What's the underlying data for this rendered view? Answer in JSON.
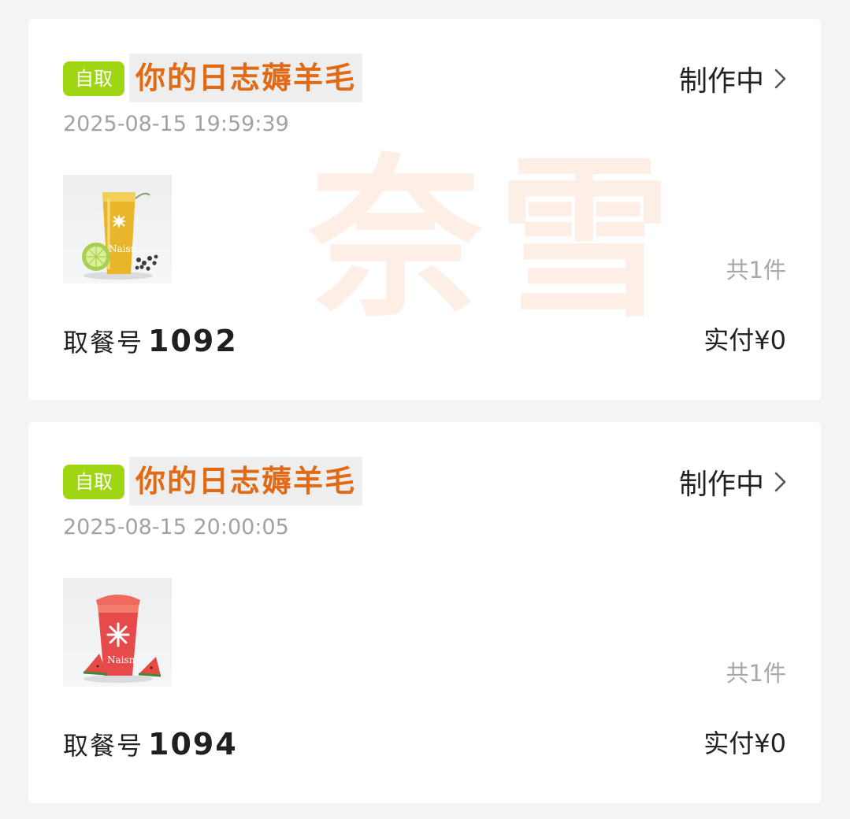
{
  "orders": [
    {
      "badge": "自取",
      "store_name": "你的日志薅羊毛",
      "status": "制作中",
      "time": "2025-08-15 19:59:39",
      "product_icon": "lemon-tea-cup",
      "count": "共1件",
      "pickup_label": "取餐号",
      "pickup_number": "1092",
      "paid": "实付¥0",
      "watermark": "奈雪"
    },
    {
      "badge": "自取",
      "store_name": "你的日志薅羊毛",
      "status": "制作中",
      "time": "2025-08-15 20:00:05",
      "product_icon": "watermelon-cup",
      "count": "共1件",
      "pickup_label": "取餐号",
      "pickup_number": "1094",
      "paid": "实付¥0"
    }
  ],
  "colors": {
    "background": "#f3f4f6",
    "card": "#ffffff",
    "badge": "#9fd614",
    "store_name": "#e06a16",
    "muted_text": "#a2a2a2"
  }
}
